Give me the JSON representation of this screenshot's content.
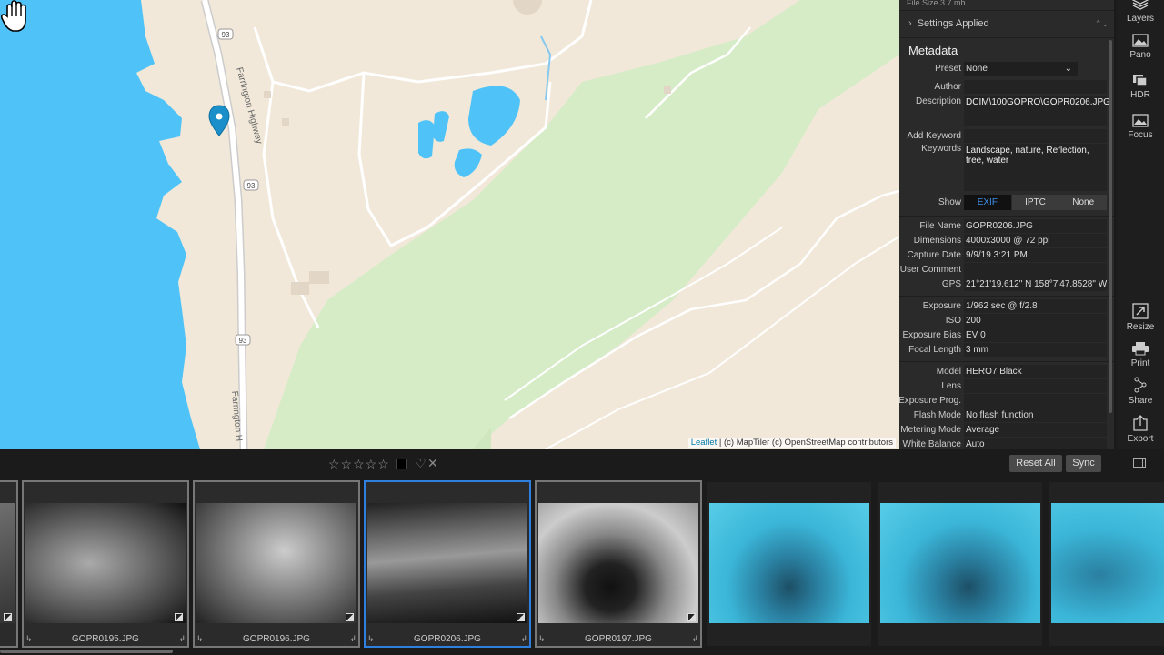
{
  "panel": {
    "file_size": "File Size 3.7 mb",
    "settings_applied": "Settings Applied",
    "metadata_title": "Metadata",
    "preset": {
      "label": "Preset",
      "value": "None"
    },
    "author": {
      "label": "Author",
      "value": ""
    },
    "description": {
      "label": "Description",
      "value": "DCIM\\100GOPRO\\GOPR0206.JPG"
    },
    "add_keyword": {
      "label": "Add Keyword",
      "value": ""
    },
    "keywords": {
      "label": "Keywords",
      "value": "Landscape, nature, Reflection, tree, water"
    },
    "show": {
      "label": "Show",
      "tabs": [
        "EXIF",
        "IPTC",
        "None"
      ],
      "selected": "EXIF"
    },
    "fields1": [
      {
        "label": "File Name",
        "value": "GOPR0206.JPG"
      },
      {
        "label": "Dimensions",
        "value": "4000x3000 @ 72 ppi"
      },
      {
        "label": "Capture Date",
        "value": "9/9/19 3:21 PM"
      },
      {
        "label": "User Comment",
        "value": ""
      },
      {
        "label": "GPS",
        "value": "21°21'19.612\" N 158°7'47.8528\" W"
      }
    ],
    "fields2": [
      {
        "label": "Exposure",
        "value": "1/962 sec @ f/2.8"
      },
      {
        "label": "ISO",
        "value": "200"
      },
      {
        "label": "Exposure Bias",
        "value": "EV 0"
      },
      {
        "label": "Focal Length",
        "value": "3 mm"
      }
    ],
    "fields3": [
      {
        "label": "Model",
        "value": "HERO7 Black"
      },
      {
        "label": "Lens",
        "value": ""
      },
      {
        "label": "Exposure Prog.",
        "value": ""
      },
      {
        "label": "Flash Mode",
        "value": "No flash function"
      },
      {
        "label": "Metering Mode",
        "value": "Average"
      },
      {
        "label": "White Balance",
        "value": "Auto"
      }
    ]
  },
  "tools": {
    "layers": "Layers",
    "pano": "Pano",
    "hdr": "HDR",
    "focus": "Focus",
    "resize": "Resize",
    "print": "Print",
    "share": "Share",
    "export": "Export"
  },
  "map": {
    "attribution_leaflet": "Leaflet",
    "attribution_rest": " | (c) MapTiler (c) OpenStreetMap contributors",
    "road_shield": "93",
    "road_name": "Farrington Highway",
    "road_name_2": "Farrington H"
  },
  "filmstrip": {
    "stars": "☆☆☆☆☆",
    "reset_all": "Reset All",
    "sync": "Sync",
    "thumbs": [
      {
        "name": "GOPR0195.JPG"
      },
      {
        "name": "GOPR0196.JPG"
      },
      {
        "name": "GOPR0206.JPG"
      },
      {
        "name": "GOPR0197.JPG"
      },
      {
        "name": ""
      },
      {
        "name": ""
      },
      {
        "name": ""
      }
    ]
  },
  "colors": {
    "accent": "#2f7fe0",
    "water": "#4fc3f7",
    "land": "#f1e8d9",
    "park": "#d4ecc4"
  }
}
